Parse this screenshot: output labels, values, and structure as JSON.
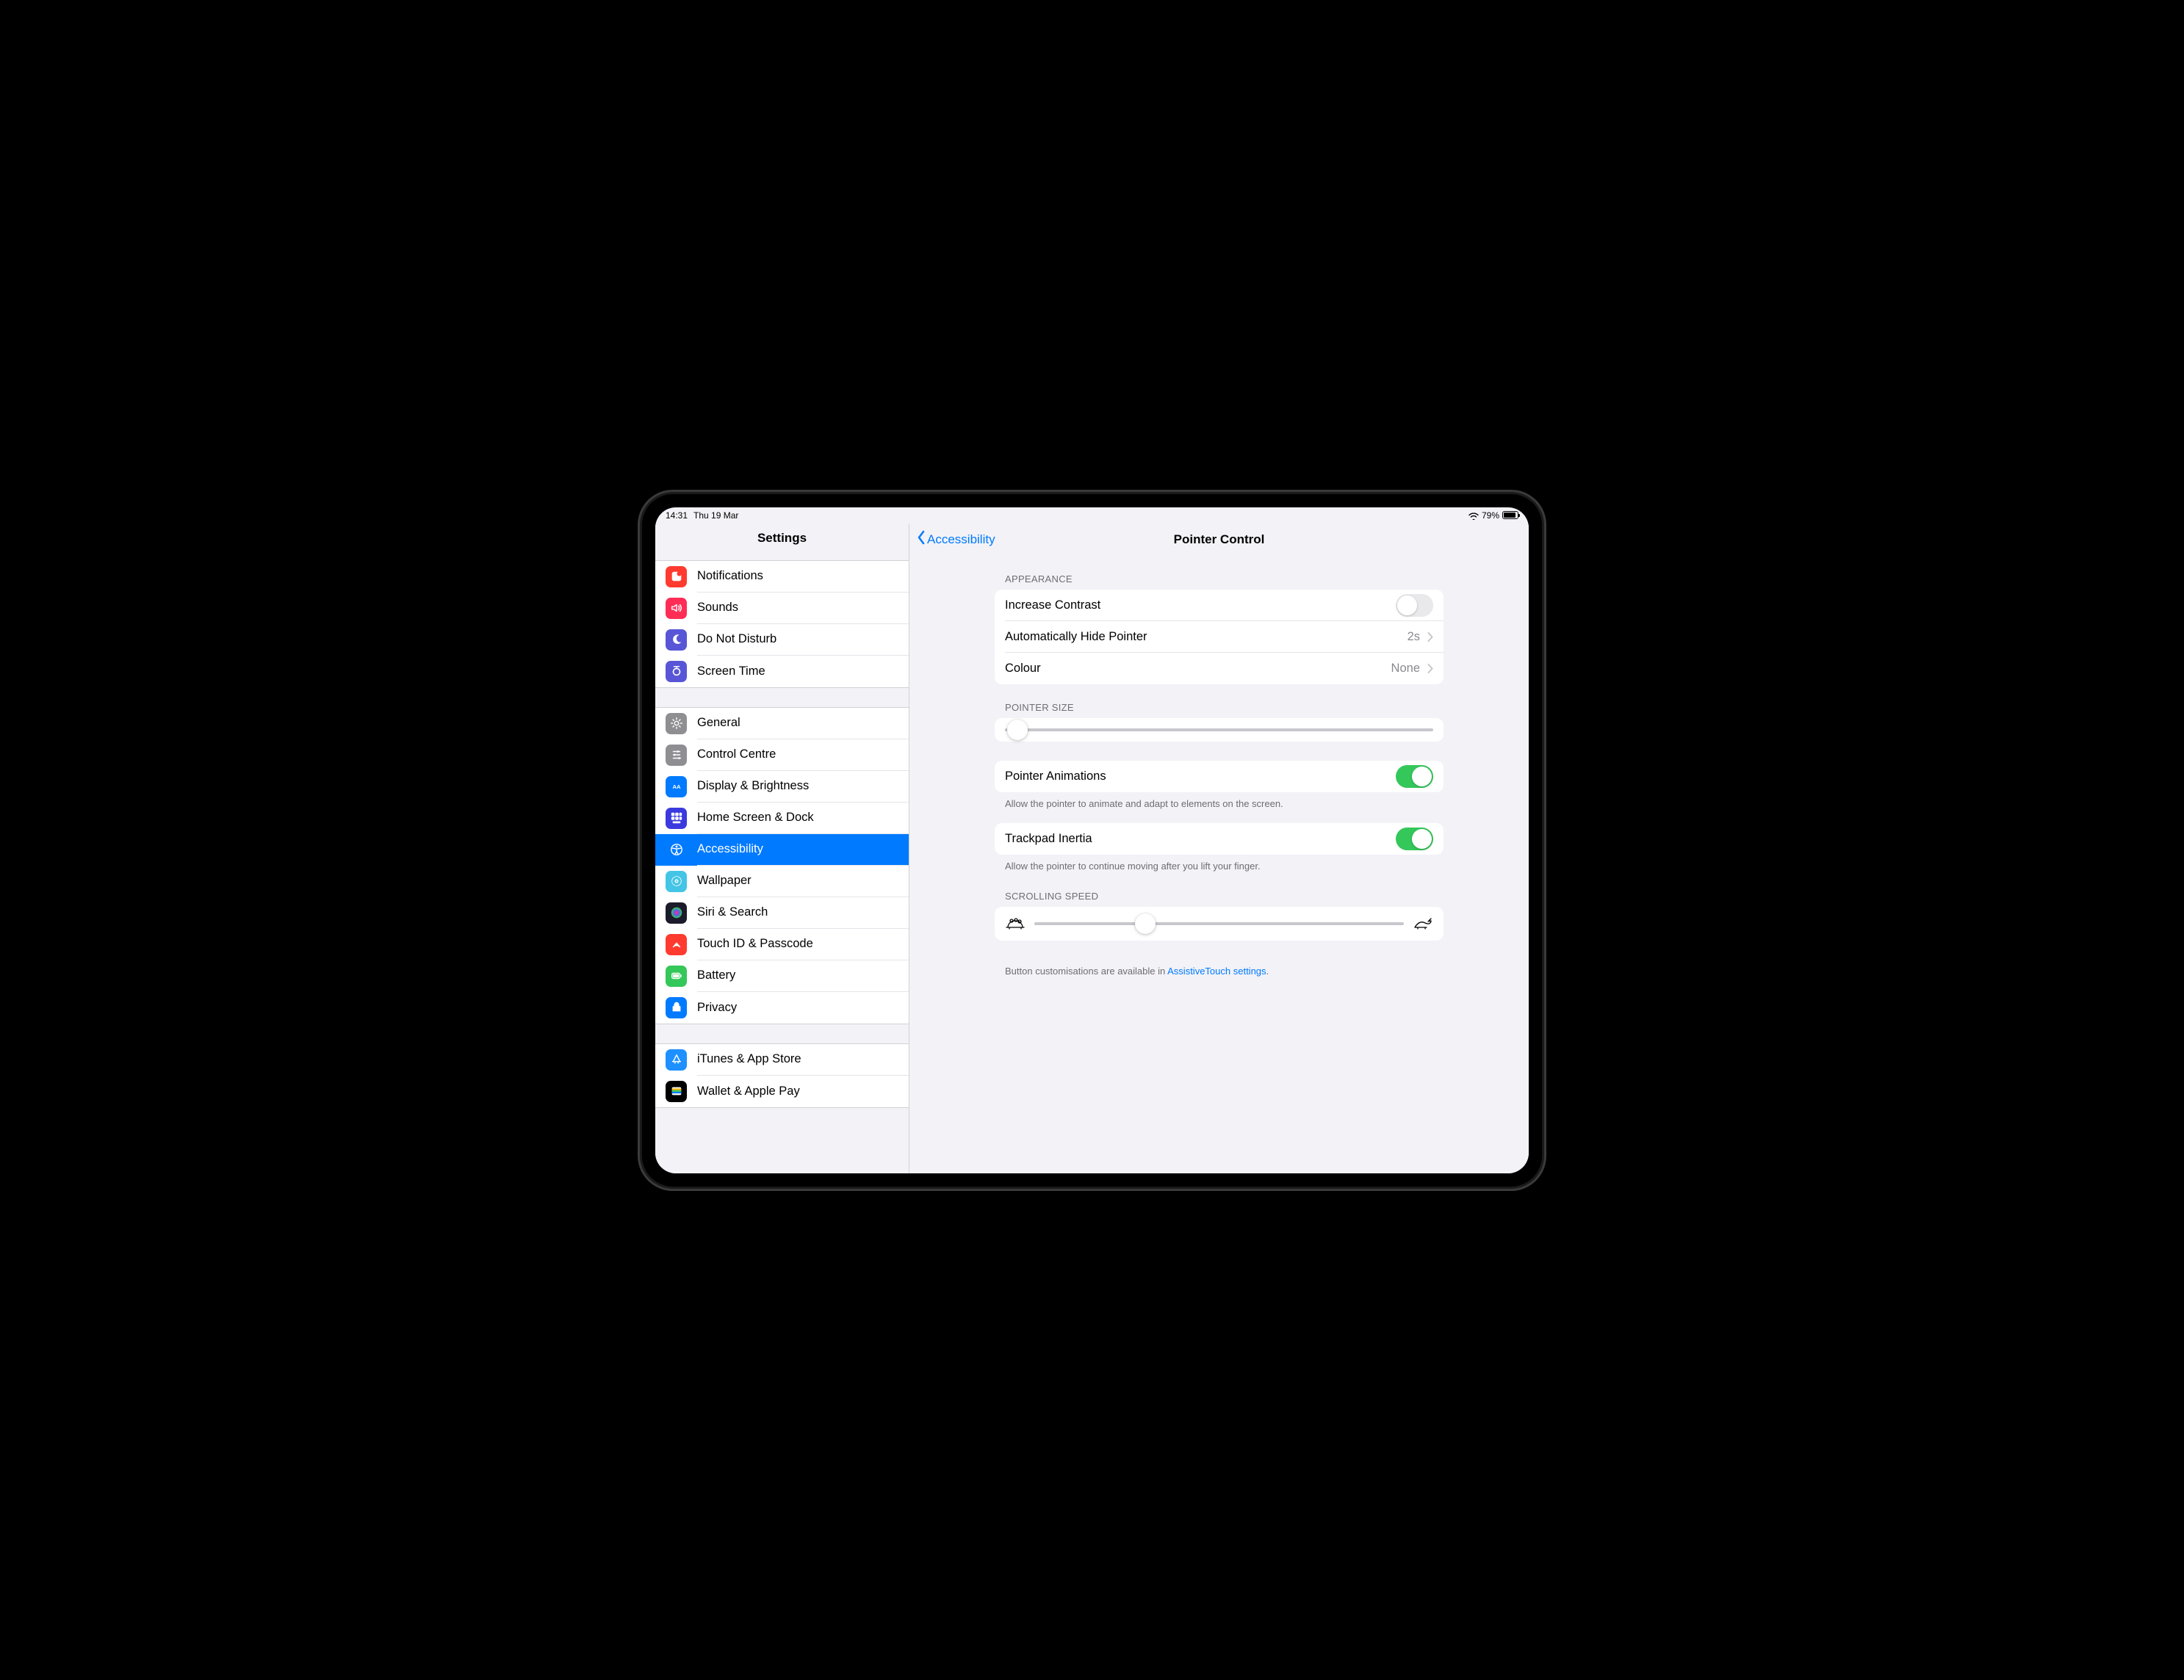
{
  "status": {
    "time": "14:31",
    "date": "Thu 19 Mar",
    "battery_pct": "79%"
  },
  "sidebar_title": "Settings",
  "sidebar": {
    "group1": [
      {
        "label": "Notifications",
        "bg": "#ff3b30",
        "icon": "notif"
      },
      {
        "label": "Sounds",
        "bg": "#ff2d55",
        "icon": "sound"
      },
      {
        "label": "Do Not Disturb",
        "bg": "#5856d6",
        "icon": "dnd"
      },
      {
        "label": "Screen Time",
        "bg": "#5856d6",
        "icon": "screentime"
      }
    ],
    "group2": [
      {
        "label": "General",
        "bg": "#8e8e93",
        "icon": "gear"
      },
      {
        "label": "Control Centre",
        "bg": "#8e8e93",
        "icon": "control"
      },
      {
        "label": "Display & Brightness",
        "bg": "#007aff",
        "icon": "display"
      },
      {
        "label": "Home Screen & Dock",
        "bg": "#3a3adf",
        "icon": "home"
      },
      {
        "label": "Accessibility",
        "bg": "#007aff",
        "icon": "accessibility",
        "selected": true
      },
      {
        "label": "Wallpaper",
        "bg": "#44c5e6",
        "icon": "wallpaper"
      },
      {
        "label": "Siri & Search",
        "bg": "#1b1b2b",
        "icon": "siri"
      },
      {
        "label": "Touch ID & Passcode",
        "bg": "#ff3b30",
        "icon": "touchid"
      },
      {
        "label": "Battery",
        "bg": "#34c759",
        "icon": "battery"
      },
      {
        "label": "Privacy",
        "bg": "#007aff",
        "icon": "privacy"
      }
    ],
    "group3": [
      {
        "label": "iTunes & App Store",
        "bg": "#1e90ff",
        "icon": "appstore"
      },
      {
        "label": "Wallet & Apple Pay",
        "bg": "#000000",
        "icon": "wallet"
      }
    ]
  },
  "detail": {
    "back_label": "Accessibility",
    "title": "Pointer Control",
    "appearance_header": "APPEARANCE",
    "rows": {
      "increase_contrast": "Increase Contrast",
      "auto_hide": "Automatically Hide Pointer",
      "auto_hide_value": "2s",
      "colour": "Colour",
      "colour_value": "None"
    },
    "pointer_size_header": "POINTER SIZE",
    "pointer_size_value": 3,
    "pointer_animations": "Pointer Animations",
    "pointer_animations_on": true,
    "pointer_animations_footer": "Allow the pointer to animate and adapt to elements on the screen.",
    "trackpad_inertia": "Trackpad Inertia",
    "trackpad_inertia_on": true,
    "trackpad_inertia_footer": "Allow the pointer to continue moving after you lift your finger.",
    "scrolling_speed_header": "SCROLLING SPEED",
    "scrolling_speed_value": 30,
    "footer_text": "Button customisations are available in ",
    "footer_link": "AssistiveTouch settings",
    "footer_after": "."
  }
}
